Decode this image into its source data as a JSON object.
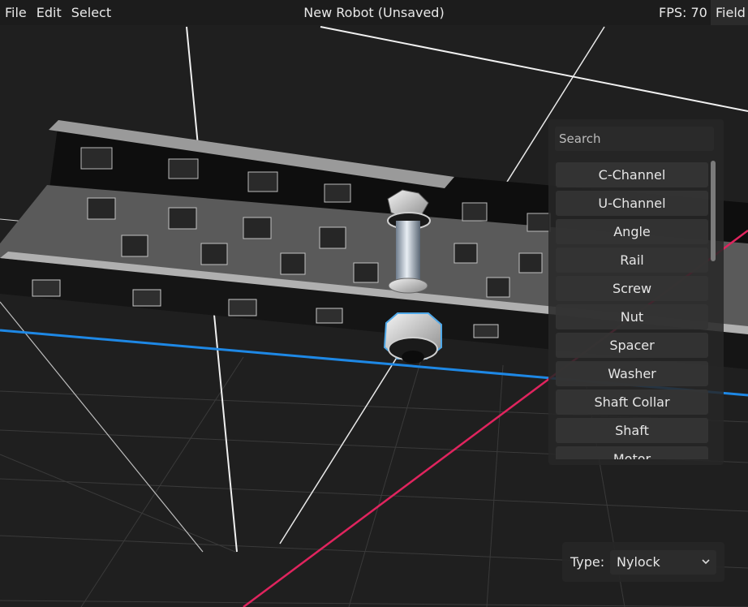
{
  "menubar": {
    "items": [
      {
        "label": "File"
      },
      {
        "label": "Edit"
      },
      {
        "label": "Select"
      }
    ],
    "title": "New Robot (Unsaved)",
    "fps": "FPS: 70",
    "field_button": "Field"
  },
  "parts_panel": {
    "search_placeholder": "Search",
    "parts": [
      "C-Channel",
      "U-Channel",
      "Angle",
      "Rail",
      "Screw",
      "Nut",
      "Spacer",
      "Washer",
      "Shaft Collar",
      "Shaft",
      "Motor"
    ],
    "scroll_fraction": 0.34
  },
  "type_panel": {
    "label": "Type:",
    "selected": "Nylock"
  },
  "colors": {
    "x_axis": "#e0245e",
    "z_axis": "#1e88e5",
    "selection": "#4fa8e8",
    "background": "#1f1f1f"
  }
}
